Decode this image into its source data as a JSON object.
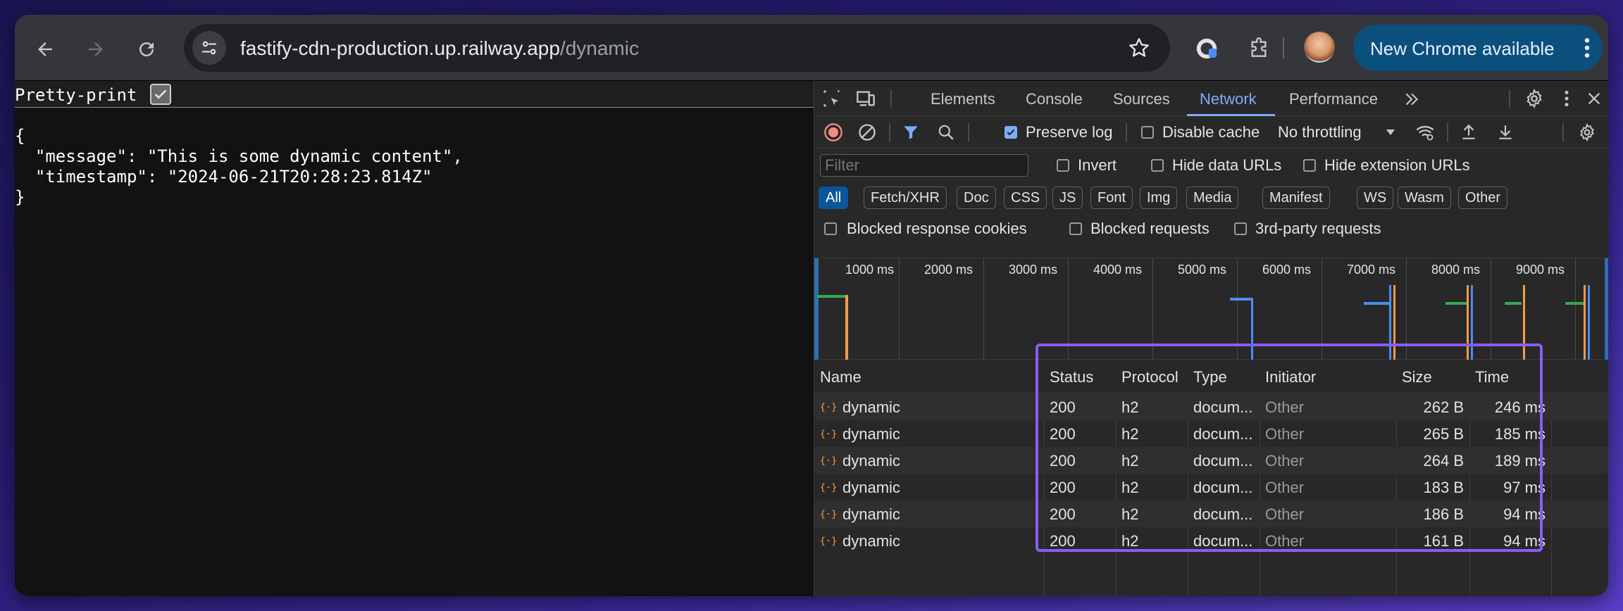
{
  "browser": {
    "url_host": "fastify-cdn-production.up.railway.app",
    "url_path": "/dynamic",
    "update_label": "New Chrome available"
  },
  "page": {
    "pretty_print_label": "Pretty-print",
    "json_text": "{\n  \"message\": \"This is some dynamic content\",\n  \"timestamp\": \"2024-06-21T20:28:23.814Z\"\n}"
  },
  "devtools": {
    "tabs": [
      "Elements",
      "Console",
      "Sources",
      "Network",
      "Performance"
    ],
    "active_tab": "Network",
    "preserve_log": "Preserve log",
    "disable_cache": "Disable cache",
    "throttling": "No throttling",
    "filter_placeholder": "Filter",
    "invert": "Invert",
    "hide_data_urls": "Hide data URLs",
    "hide_extension_urls": "Hide extension URLs",
    "type_filters": [
      "All",
      "Fetch/XHR",
      "Doc",
      "CSS",
      "JS",
      "Font",
      "Img",
      "Media",
      "Manifest",
      "WS",
      "Wasm",
      "Other"
    ],
    "blocked_response_cookies": "Blocked response cookies",
    "blocked_requests": "Blocked requests",
    "third_party_requests": "3rd-party requests",
    "timeline_ticks": [
      "1000 ms",
      "2000 ms",
      "3000 ms",
      "4000 ms",
      "5000 ms",
      "6000 ms",
      "7000 ms",
      "8000 ms",
      "9000 ms"
    ],
    "table": {
      "headers": [
        "Name",
        "Status",
        "Protocol",
        "Type",
        "Initiator",
        "Size",
        "Time"
      ],
      "rows": [
        {
          "name": "dynamic",
          "status": "200",
          "protocol": "h2",
          "type": "docum...",
          "initiator": "Other",
          "size": "262 B",
          "time": "246 ms"
        },
        {
          "name": "dynamic",
          "status": "200",
          "protocol": "h2",
          "type": "docum...",
          "initiator": "Other",
          "size": "265 B",
          "time": "185 ms"
        },
        {
          "name": "dynamic",
          "status": "200",
          "protocol": "h2",
          "type": "docum...",
          "initiator": "Other",
          "size": "264 B",
          "time": "189 ms"
        },
        {
          "name": "dynamic",
          "status": "200",
          "protocol": "h2",
          "type": "docum...",
          "initiator": "Other",
          "size": "183 B",
          "time": "97 ms"
        },
        {
          "name": "dynamic",
          "status": "200",
          "protocol": "h2",
          "type": "docum...",
          "initiator": "Other",
          "size": "186 B",
          "time": "94 ms"
        },
        {
          "name": "dynamic",
          "status": "200",
          "protocol": "h2",
          "type": "docum...",
          "initiator": "Other",
          "size": "161 B",
          "time": "94 ms"
        }
      ]
    }
  },
  "colors": {
    "accent": "#7cacf8",
    "highlight": "#8b5cf6",
    "record": "#f28b82",
    "doc_icon": "#f29b4b"
  }
}
